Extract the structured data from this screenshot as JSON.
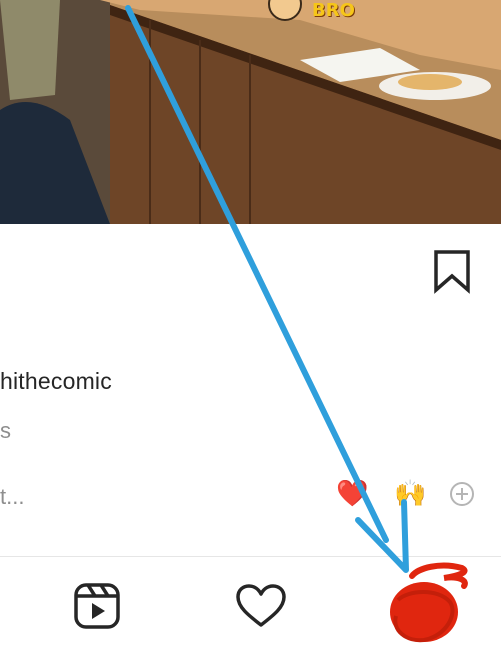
{
  "post": {
    "username_fragment": "hithecomic",
    "line2_fragment": "s",
    "line3_fragment": "t..."
  },
  "sticker_text": "BRO",
  "reactions": {
    "heart": "❤️",
    "praise": "🙌"
  },
  "nav": {
    "items": [
      "reels-icon",
      "activity-heart-icon",
      "profile-avatar"
    ]
  },
  "colors": {
    "annotation_arrow": "#2f9fdc",
    "scribble": "#e0260f"
  }
}
